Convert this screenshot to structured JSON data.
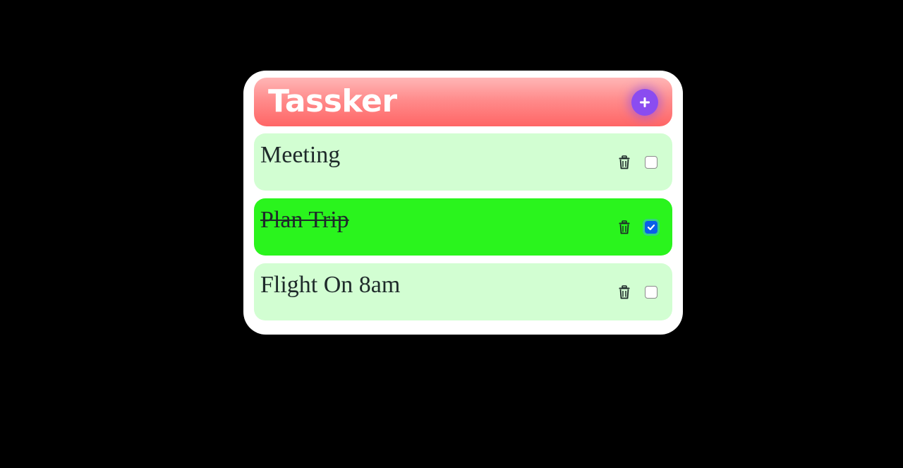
{
  "app": {
    "title": "Tassker",
    "add_icon": "plus-icon",
    "accent_color": "#8a4cf0"
  },
  "tasks": [
    {
      "text": "Meeting",
      "done": false,
      "delete_icon": "trash-icon"
    },
    {
      "text": "Plan Trip",
      "done": true,
      "delete_icon": "trash-icon"
    },
    {
      "text": "Flight On 8am",
      "done": false,
      "delete_icon": "trash-icon"
    }
  ],
  "colors": {
    "task_pending": "#d2fed2",
    "task_done": "#2af41d",
    "checkbox_checked": "#0a5fe8"
  }
}
